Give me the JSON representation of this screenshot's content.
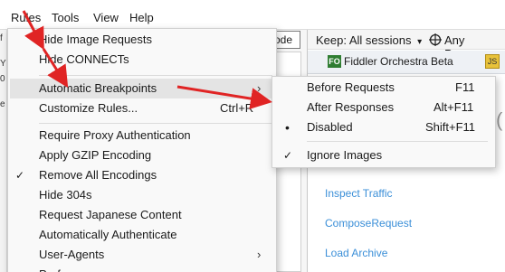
{
  "menubar": {
    "items": [
      "Rules",
      "Tools",
      "View",
      "Help"
    ]
  },
  "background": {
    "left_tiny_labels": [
      "f",
      "Y",
      "0",
      "e"
    ],
    "mid_field": "ode",
    "keep_label": "Keep: All sessions",
    "keep_arrow": "▾",
    "process_label": "Any Process",
    "tab_badge": "FO",
    "tab_label": "Fiddler Orchestra Beta",
    "links": [
      "Inspect Traffic",
      "ComposeRequest",
      "Load Archive"
    ],
    "cut_letter": "(",
    "icon_names": [
      "target-icon",
      "fiddler-orchestra-icon",
      "script-icon"
    ]
  },
  "rules_menu": {
    "items": [
      {
        "label": "Hide Image Requests",
        "shortcut": "",
        "checked": false,
        "submenu": false
      },
      {
        "label": "Hide CONNECTs",
        "shortcut": "",
        "checked": false,
        "submenu": false
      },
      {
        "label": "Automatic Breakpoints",
        "shortcut": "",
        "checked": false,
        "submenu": true
      },
      {
        "label": "Customize Rules...",
        "shortcut": "Ctrl+R",
        "checked": false,
        "submenu": false
      },
      {
        "label": "Require Proxy Authentication",
        "shortcut": "",
        "checked": false,
        "submenu": false
      },
      {
        "label": "Apply GZIP Encoding",
        "shortcut": "",
        "checked": false,
        "submenu": false
      },
      {
        "label": "Remove All Encodings",
        "shortcut": "",
        "checked": true,
        "submenu": false
      },
      {
        "label": "Hide 304s",
        "shortcut": "",
        "checked": false,
        "submenu": false
      },
      {
        "label": "Request Japanese Content",
        "shortcut": "",
        "checked": false,
        "submenu": false
      },
      {
        "label": "Automatically Authenticate",
        "shortcut": "",
        "checked": false,
        "submenu": false
      },
      {
        "label": "User-Agents",
        "shortcut": "",
        "checked": false,
        "submenu": true
      },
      {
        "label": "Perf",
        "shortcut": "",
        "checked": false,
        "submenu": true
      }
    ],
    "check_glyph": "✓",
    "arrow_glyph": "›"
  },
  "breakpoints_submenu": {
    "items": [
      {
        "label": "Before Requests",
        "shortcut": "F11",
        "mark": ""
      },
      {
        "label": "After Responses",
        "shortcut": "Alt+F11",
        "mark": ""
      },
      {
        "label": "Disabled",
        "shortcut": "Shift+F11",
        "mark": "•"
      },
      {
        "label": "Ignore Images",
        "shortcut": "",
        "mark": "✓"
      }
    ]
  },
  "colors": {
    "annotation_arrow": "#e02424",
    "link": "#3b8fd8",
    "badge_green": "#2f7d32",
    "menu_bg": "#f9f9f9",
    "menu_highlight": "#e4e4e4"
  }
}
